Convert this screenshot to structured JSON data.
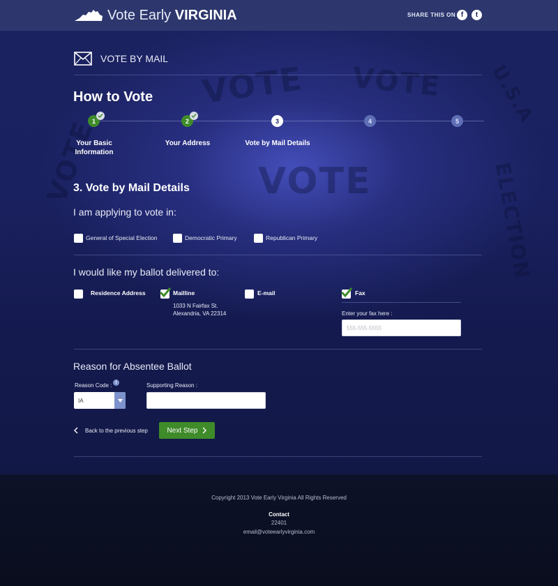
{
  "header": {
    "logo_light": "Vote Early",
    "logo_bold": "VIRGINIA",
    "share_label": "SHARE THIS ON",
    "social": [
      {
        "name": "facebook",
        "glyph": "f"
      },
      {
        "name": "twitter",
        "glyph": "t"
      }
    ]
  },
  "section": {
    "title": "VOTE BY MAIL"
  },
  "page_title": "How to Vote",
  "steps": [
    {
      "number": "1",
      "label": "Your Basic Information",
      "status": "complete"
    },
    {
      "number": "2",
      "label": "Your Address",
      "status": "complete"
    },
    {
      "number": "3",
      "label": "Vote by Mail Details",
      "status": "current"
    },
    {
      "number": "4",
      "label": "",
      "status": "upcoming"
    },
    {
      "number": "5",
      "label": "",
      "status": "upcoming"
    }
  ],
  "form": {
    "heading": "3. Vote by Mail Details",
    "election_prompt": "I am applying to vote in:",
    "election_options": [
      {
        "label": "General of Special Election",
        "checked": false
      },
      {
        "label": "Democratic Primary",
        "checked": false
      },
      {
        "label": "Republican Primary",
        "checked": false
      }
    ],
    "delivery_prompt": "I would like my ballot delivered to:",
    "delivery_options": [
      {
        "label": "Residence Address",
        "checked": false
      },
      {
        "label": "Mailline",
        "checked": true
      },
      {
        "label": "E-mail",
        "checked": false
      },
      {
        "label": "Fax",
        "checked": true
      }
    ],
    "mailline_address": [
      "1033 N Fairfax St.",
      "Alexandria, VA 22314"
    ],
    "fax_label": "Enter your fax here :",
    "fax_placeholder": "555-555-5555",
    "absentee_heading": "Reason for Absentee Ballot",
    "reason_code_label": "Reason Code :",
    "reason_code_value": "IA",
    "supporting_reason_label": "Supporting Reason :",
    "supporting_reason_value": "",
    "back_label": "Back to the previous step",
    "next_label": "Next Step"
  },
  "background_stamps": [
    "VOTE",
    "VOTE",
    "VOTE",
    "VOTE",
    "ELECTION",
    "U.S.A"
  ],
  "footer": {
    "copyright": "Copyright 2013 Vote Early Virginia All Rights Reserved",
    "contact_heading": "Contact",
    "contact_zip": "22401",
    "contact_email": "email@voteearlyvirginia.com"
  },
  "colors": {
    "accent_green": "#3f8b2a",
    "step_upcoming": "#5f6fb6",
    "select_button": "#7d92cc",
    "background_navy": "#1a2160"
  }
}
